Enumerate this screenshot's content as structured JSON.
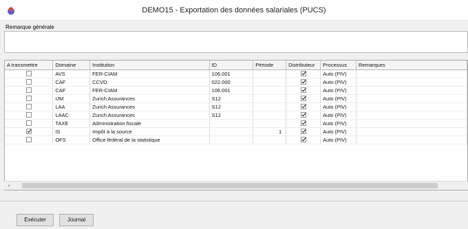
{
  "window": {
    "title": "DEMO15 - Exportation des données salariales (PUCS)"
  },
  "remark": {
    "label": "Remarque générale",
    "value": ""
  },
  "grid": {
    "columns": [
      "A transmettre",
      "Domaine",
      "Institution",
      "ID",
      "Période",
      "Distributeur",
      "Processus",
      "Remarques"
    ],
    "rows": [
      {
        "transmit": false,
        "domain": "AVS",
        "institution": "FER-CIAM",
        "id": "106.001",
        "period": "",
        "distributor": true,
        "process": "Auto (PIV)",
        "remarks": ""
      },
      {
        "transmit": false,
        "domain": "CAF",
        "institution": "CCVD",
        "id": "022.000",
        "period": "",
        "distributor": true,
        "process": "Auto (PIV)",
        "remarks": ""
      },
      {
        "transmit": false,
        "domain": "CAF",
        "institution": "FER-CIAM",
        "id": "106.001",
        "period": "",
        "distributor": true,
        "process": "Auto (PIV)",
        "remarks": ""
      },
      {
        "transmit": false,
        "domain": "IJM",
        "institution": "Zurich Assurances",
        "id": "S12",
        "period": "",
        "distributor": true,
        "process": "Auto (PIV)",
        "remarks": ""
      },
      {
        "transmit": false,
        "domain": "LAA",
        "institution": "Zurich Assurances",
        "id": "S12",
        "period": "",
        "distributor": true,
        "process": "Auto (PIV)",
        "remarks": ""
      },
      {
        "transmit": false,
        "domain": "LAAC",
        "institution": "Zurich Assurances",
        "id": "S12",
        "period": "",
        "distributor": true,
        "process": "Auto (PIV)",
        "remarks": ""
      },
      {
        "transmit": false,
        "domain": "TAXE",
        "institution": "Administration fiscale",
        "id": "",
        "period": "",
        "distributor": true,
        "process": "Auto (PIV)",
        "remarks": ""
      },
      {
        "transmit": true,
        "domain": "IS",
        "institution": "Impôt à la source",
        "id": "",
        "period": "1",
        "distributor": true,
        "process": "Auto (PIV)",
        "remarks": ""
      },
      {
        "transmit": false,
        "domain": "OFS",
        "institution": "Office fédéral de la statistique",
        "id": "",
        "period": "",
        "distributor": true,
        "process": "Auto (PIV)",
        "remarks": ""
      }
    ]
  },
  "buttons": {
    "execute": "Exécuter",
    "journal": "Journal"
  },
  "icons": {
    "app": "app-logo-icon",
    "scroll_left": "chevron-left-icon"
  }
}
